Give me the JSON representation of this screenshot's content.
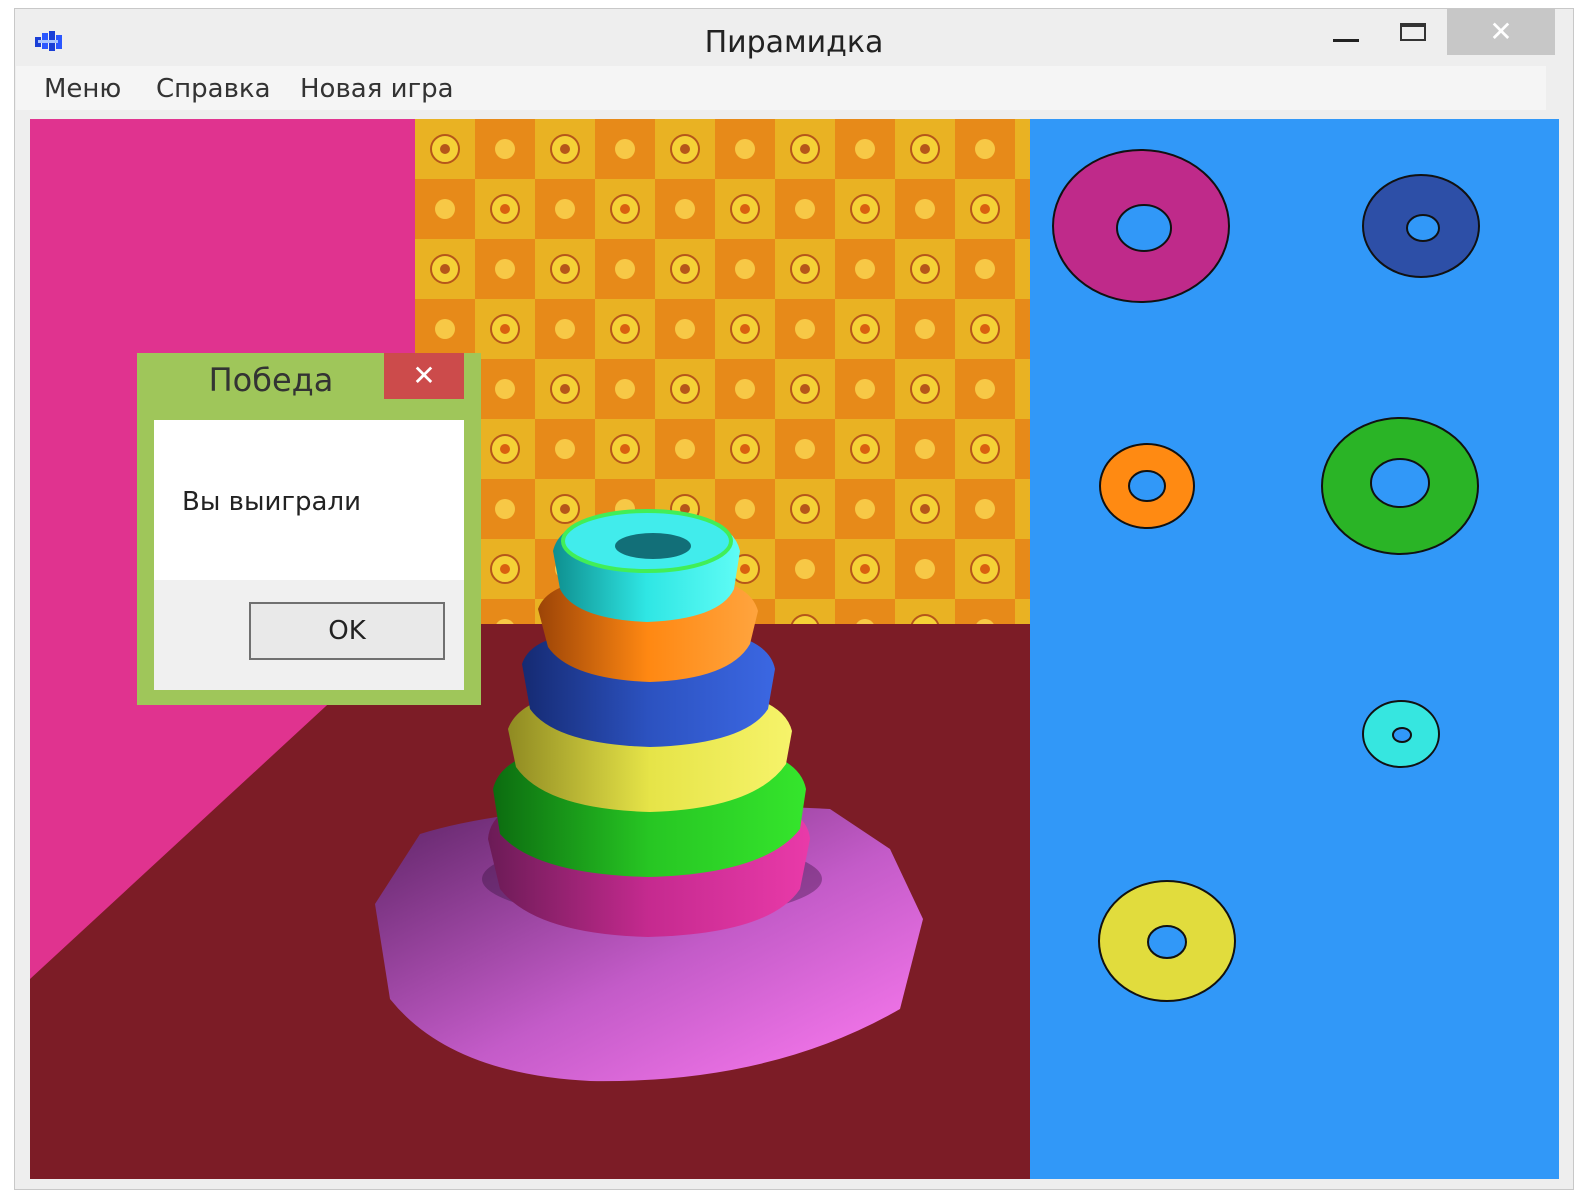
{
  "window": {
    "title": "Пирамидка"
  },
  "menu": {
    "items": [
      "Меню",
      "Справка",
      "Новая игра"
    ]
  },
  "dialog": {
    "title": "Победа",
    "message": "Вы выиграли",
    "ok_label": "OK"
  },
  "colors": {
    "side_panel": "#3198f8",
    "left_wall": "#e0338f",
    "floor": "#7c1c26",
    "rings": [
      "#bf2a8a",
      "#2d4fa7",
      "#ff8a12",
      "#2ab426",
      "#36e6e0",
      "#e1dc3d"
    ]
  }
}
